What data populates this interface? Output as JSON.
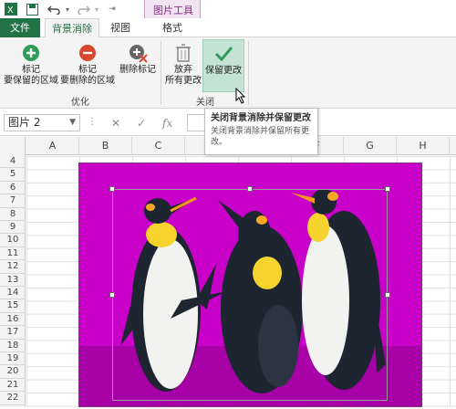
{
  "titlebar": {
    "context_group": "图片工具"
  },
  "tabs": {
    "file": "文件",
    "background_removal": "背景消除",
    "view": "视图",
    "format": "格式"
  },
  "ribbon": {
    "mark_keep": [
      "标记",
      "要保留的区域"
    ],
    "mark_remove": [
      "标记",
      "要删除的区域"
    ],
    "delete_mark": "删除标记",
    "discard_all": [
      "放弃",
      "所有更改"
    ],
    "keep_changes": "保留更改",
    "group_optimize": "优化",
    "group_close": "关闭"
  },
  "formula_bar": {
    "name_box": "图片 2",
    "fx": "fx"
  },
  "tooltip": {
    "title": "关闭背景消除并保留更改",
    "body": "关闭背景消除并保留所有更改。"
  },
  "grid": {
    "columns": [
      "A",
      "B",
      "C",
      "D",
      "E",
      "F",
      "G",
      "H"
    ],
    "rows": [
      "4",
      "5",
      "6",
      "7",
      "8",
      "9",
      "10",
      "11",
      "12",
      "13",
      "14",
      "15",
      "16",
      "17",
      "18",
      "19",
      "20",
      "21",
      "22"
    ]
  },
  "colors": {
    "excel_green": "#217346",
    "removed_background": "#c800c8",
    "context_tab": "#8a2b8a"
  }
}
